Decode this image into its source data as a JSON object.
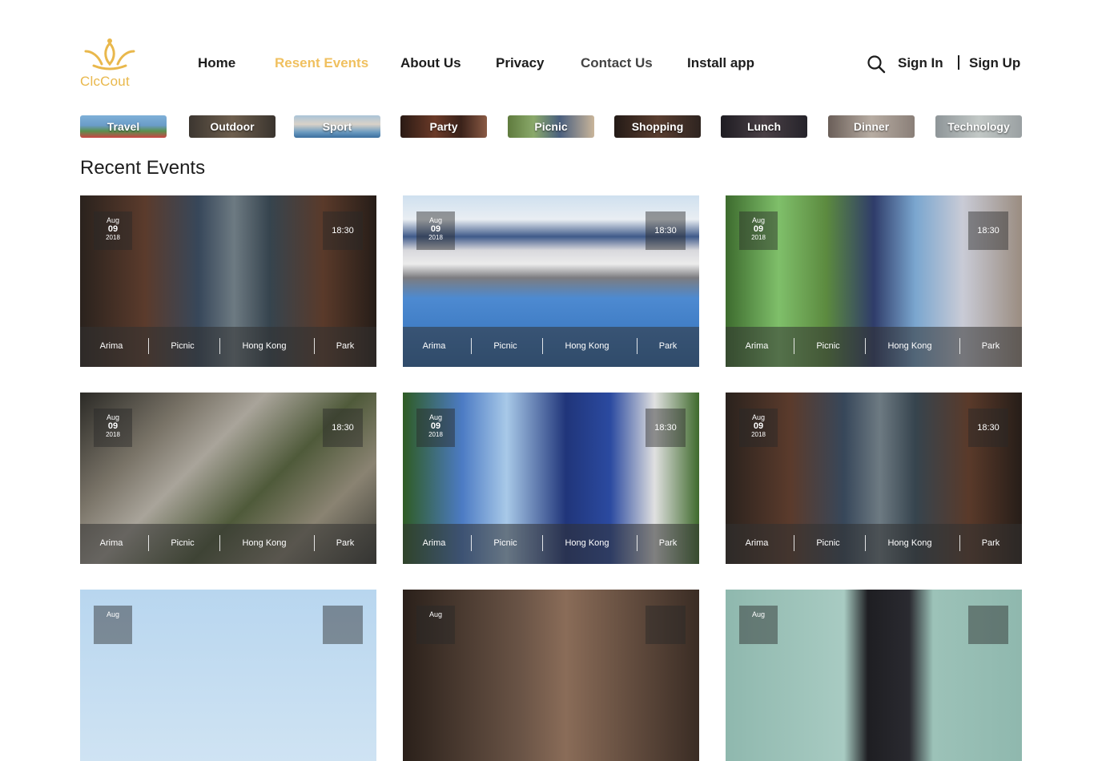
{
  "brand": {
    "name": "ClcCout",
    "color": "#e9b84c"
  },
  "nav": {
    "links": [
      "Home",
      "Resent Events",
      "About Us",
      "Privacy",
      "Contact Us",
      "Install app"
    ],
    "active": "Resent Events",
    "sign_in": "Sign In",
    "sign_up": "Sign Up",
    "search_icon": "search-icon"
  },
  "categories": [
    "Travel",
    "Outdoor",
    "Sport",
    "Party",
    "Picnic",
    "Shopping",
    "Lunch",
    "Dinner",
    "Technology"
  ],
  "section_title": "Recent Events",
  "events": [
    {
      "month": "Aug",
      "day": "09",
      "year": "2018",
      "time": "18:30",
      "name": "Arima",
      "type": "Picnic",
      "city": "Hong Kong",
      "venue": "Park",
      "scene": "alley"
    },
    {
      "month": "Aug",
      "day": "09",
      "year": "2018",
      "time": "18:30",
      "name": "Arima",
      "type": "Picnic",
      "city": "Hong Kong",
      "venue": "Park",
      "scene": "track"
    },
    {
      "month": "Aug",
      "day": "09",
      "year": "2018",
      "time": "18:30",
      "name": "Arima",
      "type": "Picnic",
      "city": "Hong Kong",
      "venue": "Park",
      "scene": "buffet"
    },
    {
      "month": "Aug",
      "day": "09",
      "year": "2018",
      "time": "18:30",
      "name": "Arima",
      "type": "Picnic",
      "city": "Hong Kong",
      "venue": "Park",
      "scene": "rocks"
    },
    {
      "month": "Aug",
      "day": "09",
      "year": "2018",
      "time": "18:30",
      "name": "Arima",
      "type": "Picnic",
      "city": "Hong Kong",
      "venue": "Park",
      "scene": "tug"
    },
    {
      "month": "Aug",
      "day": "09",
      "year": "2018",
      "time": "18:30",
      "name": "Arima",
      "type": "Picnic",
      "city": "Hong Kong",
      "venue": "Park",
      "scene": "alley"
    },
    {
      "month": "Aug",
      "scene": "sky"
    },
    {
      "month": "Aug",
      "scene": "dark"
    },
    {
      "month": "Aug",
      "scene": "court"
    }
  ],
  "colors": {
    "accent": "#f0c05f",
    "text": "#1d1d1d"
  }
}
